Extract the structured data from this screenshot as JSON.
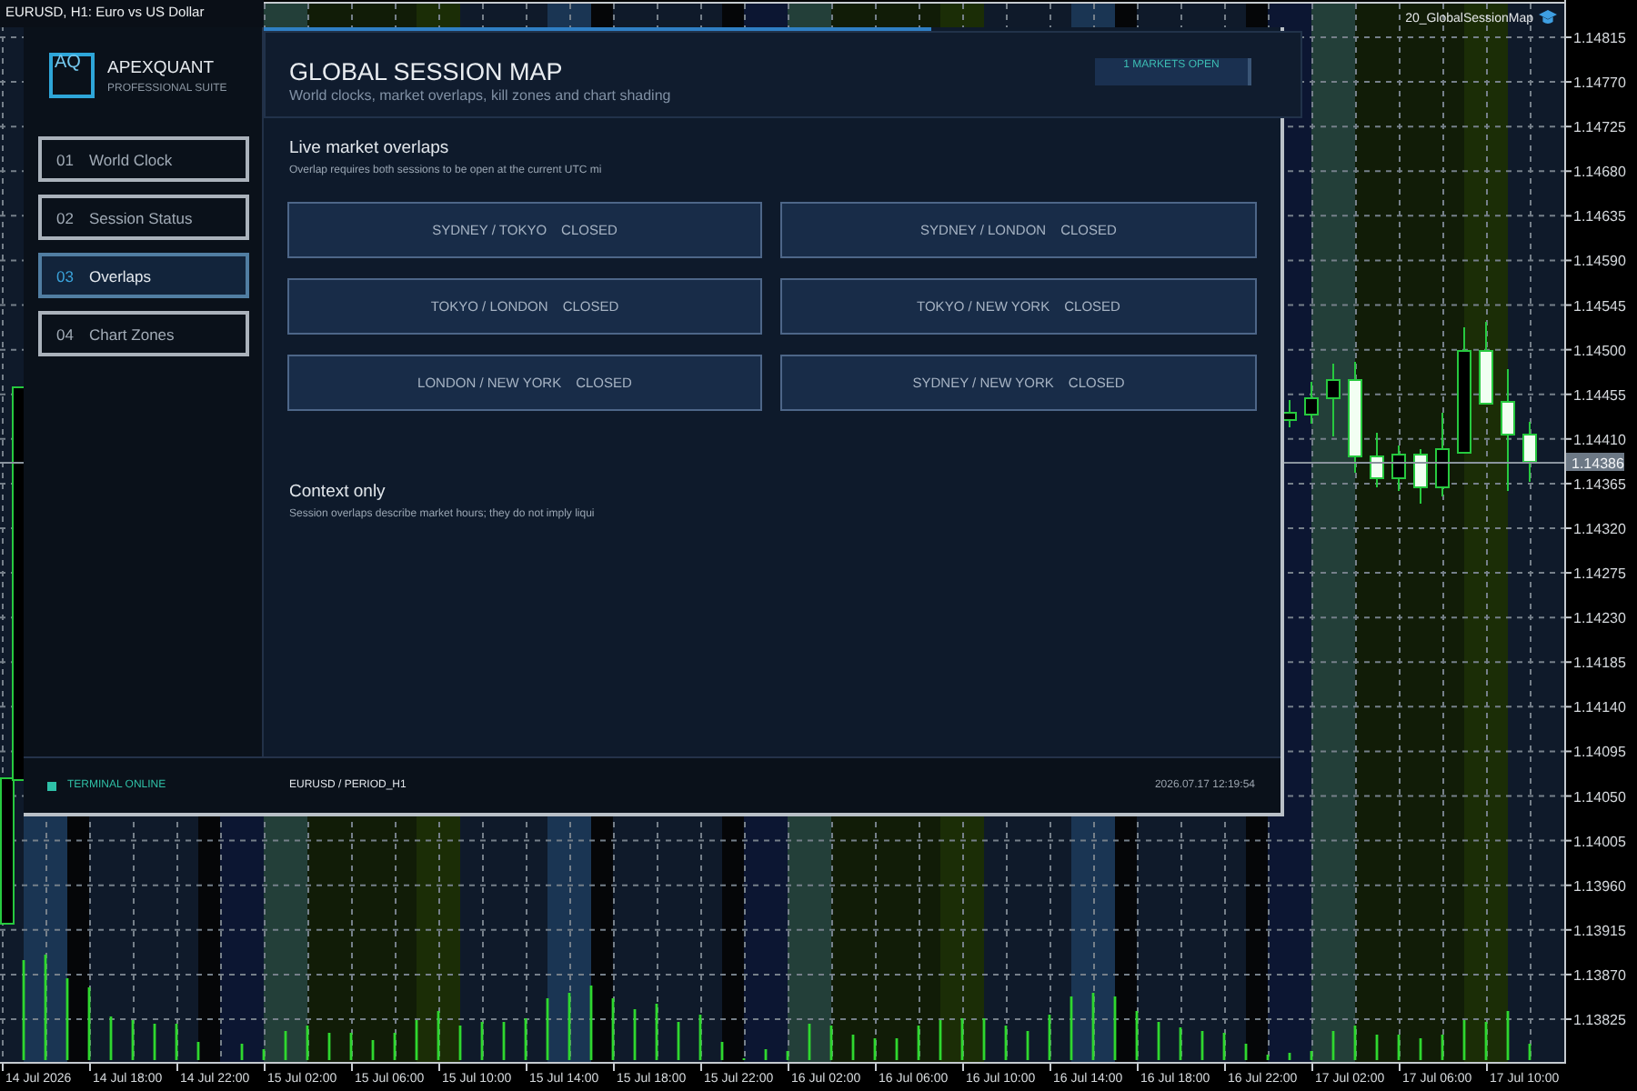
{
  "chart": {
    "title": "EURUSD, H1: Euro vs US Dollar",
    "indicator": "20_GlobalSessionMap",
    "price_axis": [
      "1.14815",
      "1.14770",
      "1.14725",
      "1.14680",
      "1.14635",
      "1.14590",
      "1.14545",
      "1.14500",
      "1.14455",
      "1.14410",
      "1.14365",
      "1.14320",
      "1.14275",
      "1.14230",
      "1.14185",
      "1.14140",
      "1.14095",
      "1.14050",
      "1.14005",
      "1.13960",
      "1.13915",
      "1.13870",
      "1.13825"
    ],
    "current_price": "1.14386",
    "time_axis": [
      "14 Jul 2026",
      "14 Jul 18:00",
      "14 Jul 22:00",
      "15 Jul 02:00",
      "15 Jul 06:00",
      "15 Jul 10:00",
      "15 Jul 14:00",
      "15 Jul 18:00",
      "15 Jul 22:00",
      "16 Jul 02:00",
      "16 Jul 06:00",
      "16 Jul 10:00",
      "16 Jul 14:00",
      "16 Jul 18:00",
      "16 Jul 22:00",
      "17 Jul 02:00",
      "17 Jul 06:00",
      "17 Jul 10:00"
    ]
  },
  "panel": {
    "logo": {
      "mark": "AQ",
      "name": "APEXQUANT",
      "tagline": "PROFESSIONAL SUITE"
    },
    "nav": [
      {
        "number": "01",
        "label": "World Clock",
        "selected": false
      },
      {
        "number": "02",
        "label": "Session Status",
        "selected": false
      },
      {
        "number": "03",
        "label": "Overlaps",
        "selected": true
      },
      {
        "number": "04",
        "label": "Chart Zones",
        "selected": false
      }
    ],
    "header": {
      "title": "GLOBAL SESSION MAP",
      "subtitle": "World clocks, market overlaps, kill zones and chart shading",
      "badge": "1 MARKETS OPEN"
    },
    "overlaps": {
      "title": "Live market overlaps",
      "note": "Overlap requires both sessions to be open at the current UTC mi",
      "cards": [
        {
          "pair": "SYDNEY / TOKYO",
          "status": "CLOSED"
        },
        {
          "pair": "SYDNEY / LONDON",
          "status": "CLOSED"
        },
        {
          "pair": "TOKYO / LONDON",
          "status": "CLOSED"
        },
        {
          "pair": "TOKYO / NEW YORK",
          "status": "CLOSED"
        },
        {
          "pair": "LONDON / NEW YORK",
          "status": "CLOSED"
        },
        {
          "pair": "SYDNEY / NEW YORK",
          "status": "CLOSED"
        }
      ]
    },
    "context": {
      "title": "Context only",
      "note": "Session overlaps describe market hours; they do not imply liqui"
    },
    "status_bar": {
      "status": "TERMINAL ONLINE",
      "symbol": "EURUSD / PERIOD_H1",
      "time": "2026.07.17 12:19:54"
    }
  }
}
